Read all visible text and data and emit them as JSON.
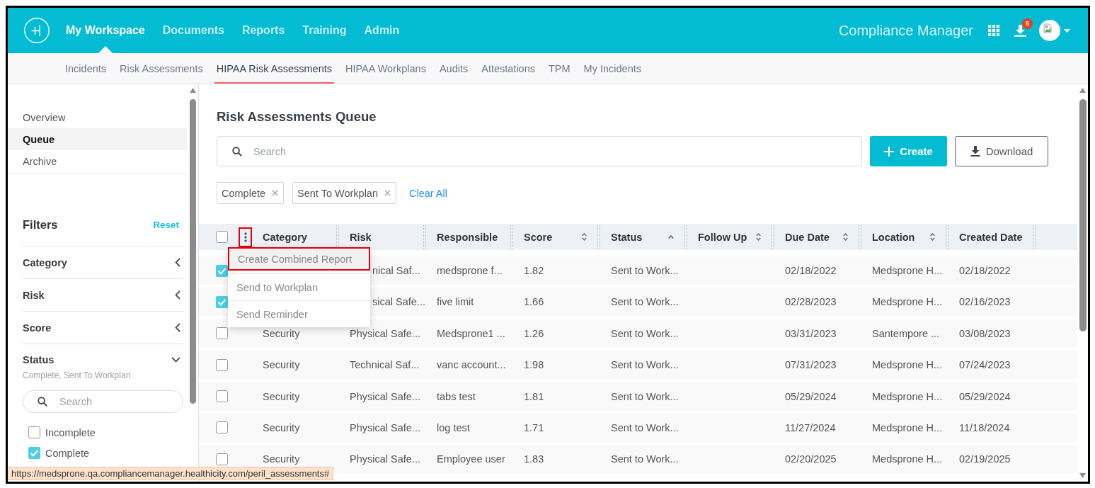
{
  "header": {
    "nav": [
      {
        "label": "My Workspace",
        "selected": true
      },
      {
        "label": "Documents",
        "selected": false
      },
      {
        "label": "Reports",
        "selected": false
      },
      {
        "label": "Training",
        "selected": false
      },
      {
        "label": "Admin",
        "selected": false
      }
    ],
    "product_name": "Compliance Manager",
    "downloads_badge": "5"
  },
  "subnav": [
    {
      "label": "Incidents",
      "selected": false
    },
    {
      "label": "Risk Assessments",
      "selected": false
    },
    {
      "label": "HIPAA Risk Assessments",
      "selected": true
    },
    {
      "label": "HIPAA Workplans",
      "selected": false
    },
    {
      "label": "Audits",
      "selected": false
    },
    {
      "label": "Attestations",
      "selected": false
    },
    {
      "label": "TPM",
      "selected": false
    },
    {
      "label": "My Incidents",
      "selected": false
    }
  ],
  "sidebar": {
    "nav": [
      {
        "label": "Overview",
        "selected": false
      },
      {
        "label": "Queue",
        "selected": true
      },
      {
        "label": "Archive",
        "selected": false
      }
    ],
    "filters": {
      "title": "Filters",
      "reset": "Reset",
      "sections": [
        {
          "label": "Category",
          "expanded": false
        },
        {
          "label": "Risk",
          "expanded": false
        },
        {
          "label": "Score",
          "expanded": false
        },
        {
          "label": "Status",
          "expanded": true,
          "summary": "Complete, Sent To Workplan",
          "search": {
            "placeholder": "Search"
          },
          "options": [
            {
              "label": "Incomplete",
              "checked": false
            },
            {
              "label": "Complete",
              "checked": true
            }
          ]
        }
      ]
    }
  },
  "main": {
    "title": "Risk Assessments Queue",
    "search": {
      "placeholder": "Search"
    },
    "buttons": [
      {
        "kind": "create",
        "label": "Create"
      },
      {
        "kind": "download",
        "label": "Download"
      }
    ],
    "chips": [
      {
        "label": "Complete"
      },
      {
        "label": "Sent To Workplan"
      }
    ],
    "clear_all": "Clear All"
  },
  "table": {
    "select_all_checked": false,
    "actions_button": {
      "highlighted": true
    },
    "actions_menu": {
      "open": true,
      "items": [
        {
          "label": "Create Combined Report",
          "highlighted": true
        },
        {
          "label": "Send to Workplan",
          "highlighted": false
        },
        {
          "label": "Send Reminder",
          "highlighted": false
        }
      ]
    },
    "columns": [
      {
        "label": "Category",
        "kind": "plain"
      },
      {
        "label": "Risk",
        "kind": "plain"
      },
      {
        "label": "Responsible",
        "kind": "plain"
      },
      {
        "label": "Score",
        "kind": "sortable"
      },
      {
        "label": "Status",
        "kind": "sorted"
      },
      {
        "label": "Follow Up",
        "kind": "sortable"
      },
      {
        "label": "Due Date",
        "kind": "sortable"
      },
      {
        "label": "Location",
        "kind": "sortable"
      },
      {
        "label": "Created Date",
        "kind": "plain"
      }
    ],
    "rows": [
      {
        "checked": true,
        "cells": [
          null,
          "nical Saf...",
          "medsprone f...",
          "1.82",
          "Sent to Work...",
          null,
          "02/18/2022",
          "Medsprone H...",
          "02/18/2022"
        ]
      },
      {
        "checked": true,
        "cells": [
          null,
          "sical Safe...",
          "five limit",
          "1.66",
          "Sent to Work...",
          null,
          "02/28/2023",
          "Medsprone H...",
          "02/16/2023"
        ]
      },
      {
        "checked": false,
        "cells": [
          "Security",
          "Physical Safe...",
          "Medsprone1 ...",
          "1.26",
          "Sent to Work...",
          null,
          "03/31/2023",
          "Santempore ...",
          "03/08/2023"
        ]
      },
      {
        "checked": false,
        "cells": [
          "Security",
          "Technical Saf...",
          "vanc account...",
          "1.98",
          "Sent to Work...",
          null,
          "07/31/2023",
          "Medsprone H...",
          "07/24/2023"
        ]
      },
      {
        "checked": false,
        "cells": [
          "Security",
          "Physical Safe...",
          "tabs test",
          "1.81",
          "Sent to Work...",
          null,
          "05/29/2024",
          "Medsprone H...",
          "05/29/2024"
        ]
      },
      {
        "checked": false,
        "cells": [
          "Security",
          "Physical Safe...",
          "log test",
          "1.71",
          "Sent to Work...",
          null,
          "11/27/2024",
          "Medsprone H...",
          "11/18/2024"
        ]
      },
      {
        "checked": false,
        "cells": [
          "Security",
          "Physical Safe...",
          "Employee user",
          "1.83",
          "Sent to Work...",
          null,
          "02/20/2025",
          "Medsprone H...",
          "02/19/2025"
        ]
      }
    ]
  },
  "status_bar": {
    "url": "https://medsprone.qa.compliancemanager.healthicity.com/peril_assessments#"
  }
}
